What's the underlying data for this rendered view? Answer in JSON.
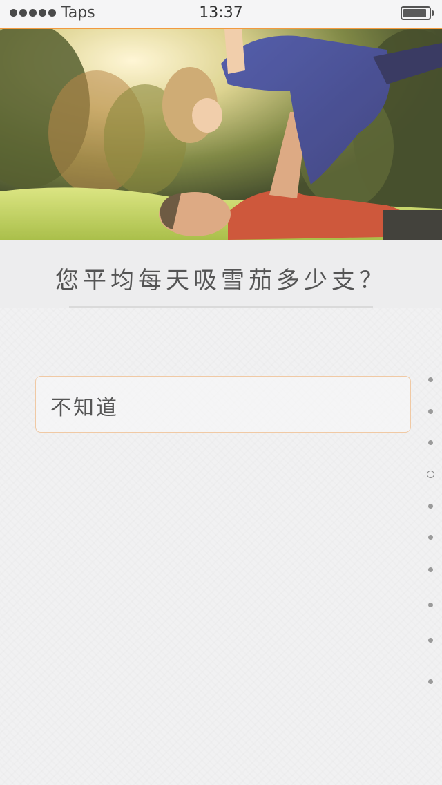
{
  "status_bar": {
    "carrier": "Taps",
    "time": "13:37",
    "battery_level": 0.8
  },
  "hero": {
    "description_icon": "photo-father-lifting-child"
  },
  "question": {
    "text": "您平均每天吸雪茄多少支？"
  },
  "answers": [
    {
      "label": "不知道"
    }
  ],
  "pager": {
    "total": 10,
    "active_index": 3
  },
  "colors": {
    "accent": "#f29a3f",
    "answer_border": "#f0c9a4",
    "text": "#555555",
    "background": "#f1f1f2"
  }
}
